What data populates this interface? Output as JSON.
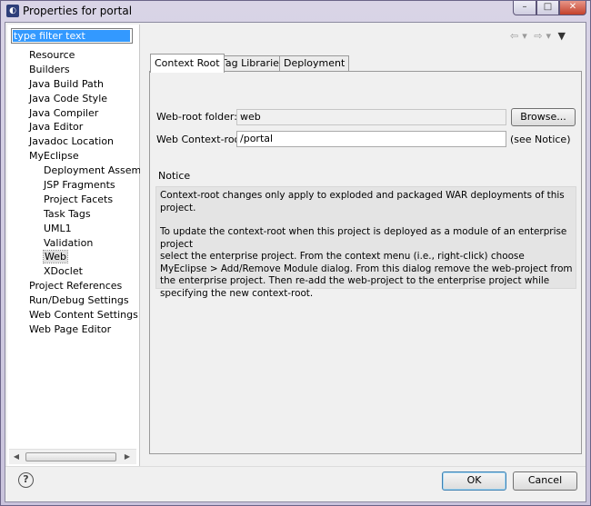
{
  "window": {
    "title": "Properties for portal",
    "minimize_glyph": "–",
    "maximize_glyph": "□",
    "close_glyph": "✕"
  },
  "filter": {
    "placeholder": "type filter text"
  },
  "tree": {
    "items": [
      {
        "label": "Resource",
        "level": 0
      },
      {
        "label": "Builders",
        "level": 0
      },
      {
        "label": "Java Build Path",
        "level": 0
      },
      {
        "label": "Java Code Style",
        "level": 0
      },
      {
        "label": "Java Compiler",
        "level": 0
      },
      {
        "label": "Java Editor",
        "level": 0
      },
      {
        "label": "Javadoc Location",
        "level": 0
      },
      {
        "label": "MyEclipse",
        "level": 0
      },
      {
        "label": "Deployment Assembl",
        "level": 1
      },
      {
        "label": "JSP Fragments",
        "level": 1
      },
      {
        "label": "Project Facets",
        "level": 1
      },
      {
        "label": "Task Tags",
        "level": 1
      },
      {
        "label": "UML1",
        "level": 1
      },
      {
        "label": "Validation",
        "level": 1
      },
      {
        "label": "Web",
        "level": 1,
        "selected": true
      },
      {
        "label": "XDoclet",
        "level": 1
      },
      {
        "label": "Project References",
        "level": 0
      },
      {
        "label": "Run/Debug Settings",
        "level": 0
      },
      {
        "label": "Web Content Settings",
        "level": 0
      },
      {
        "label": "Web Page Editor",
        "level": 0
      }
    ]
  },
  "nav": {
    "back": "⇦",
    "forward": "⇨",
    "dropdown": "▾",
    "menu": "▼"
  },
  "tabs": [
    "Context Root",
    "Tag Libraries",
    "Deployment"
  ],
  "form": {
    "webroot_label": "Web-root folder:",
    "webroot_value": "web",
    "browse_label": "Browse...",
    "context_label": "Web Context-root:",
    "context_value": "/portal",
    "see_notice": "(see Notice)",
    "notice_title": "Notice",
    "notice_p1": "Context-root changes only apply to exploded and packaged WAR deployments of this project.",
    "notice_p2": "To update the context-root when this project is deployed as a module of an enterprise project\nselect the enterprise project. From the context menu (i.e., right-click) choose\nMyEclipse > Add/Remove Module dialog. From this dialog remove the web-project from\nthe enterprise project. Then re-add the web-project to the enterprise project while\nspecifying the new context-root."
  },
  "footer": {
    "help_glyph": "?",
    "ok_label": "OK",
    "cancel_label": "Cancel"
  }
}
